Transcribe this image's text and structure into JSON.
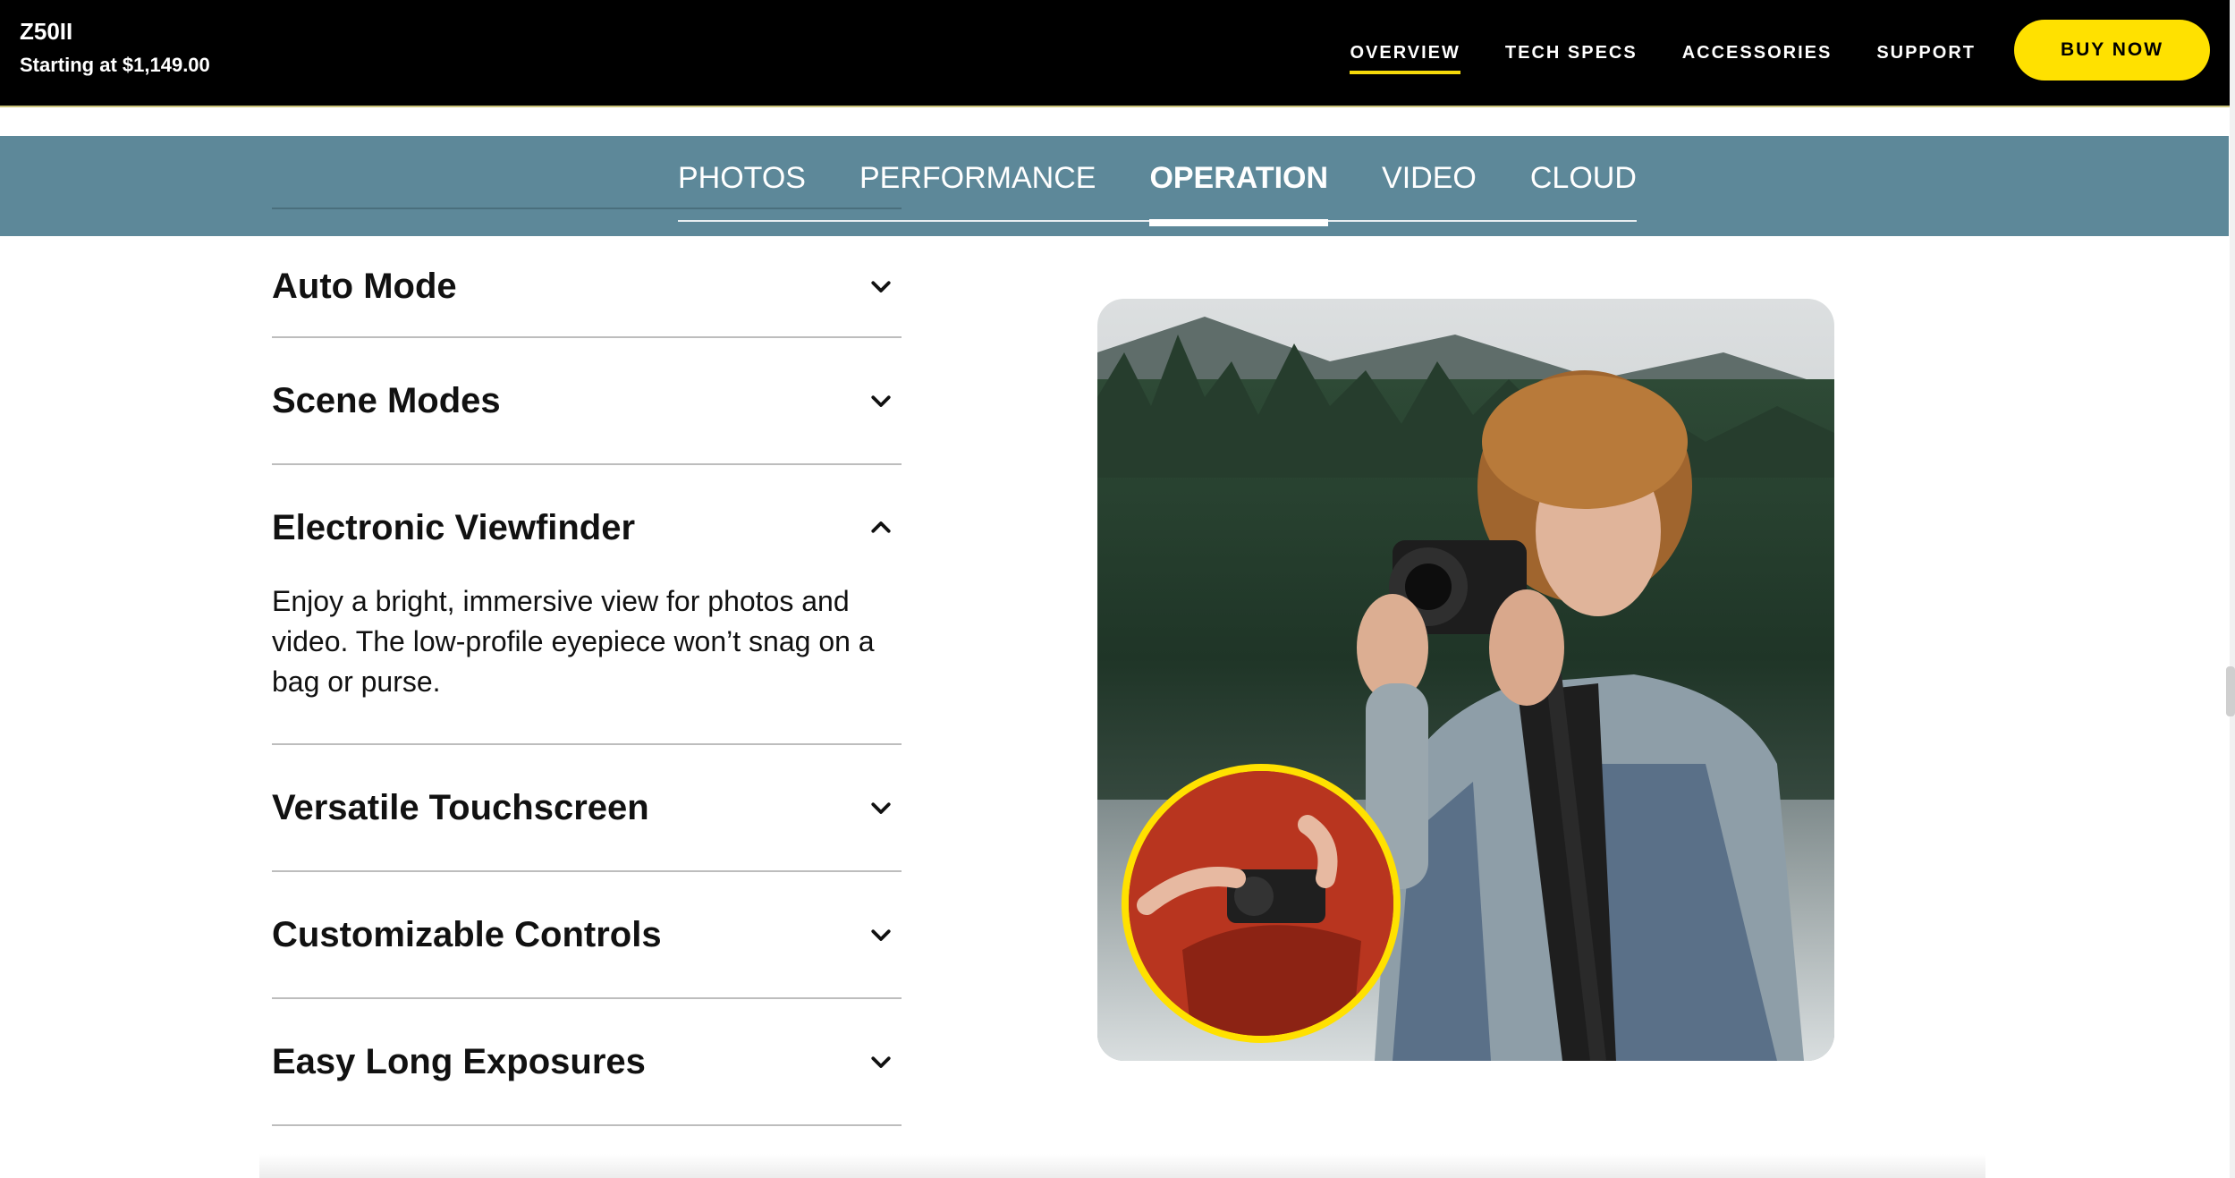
{
  "header": {
    "model": "Z50II",
    "price": "Starting at $1,149.00",
    "nav": [
      {
        "label": "OVERVIEW",
        "active": true
      },
      {
        "label": "TECH SPECS",
        "active": false
      },
      {
        "label": "ACCESSORIES",
        "active": false
      },
      {
        "label": "SUPPORT",
        "active": false
      }
    ],
    "buy_label": "BUY NOW"
  },
  "subnav": {
    "tabs": [
      {
        "label": "PHOTOS",
        "active": false
      },
      {
        "label": "PERFORMANCE",
        "active": false
      },
      {
        "label": "OPERATION",
        "active": true
      },
      {
        "label": "VIDEO",
        "active": false
      },
      {
        "label": "CLOUD",
        "active": false
      }
    ]
  },
  "accordion": {
    "items": [
      {
        "title": "Auto Mode",
        "expanded": false,
        "icon": "chevron-down-icon"
      },
      {
        "title": "Scene Modes",
        "expanded": false,
        "icon": "chevron-down-icon"
      },
      {
        "title": "Electronic Viewfinder",
        "expanded": true,
        "icon": "chevron-up-icon",
        "body": "Enjoy a bright, immersive view for photos and video. The low-profile eyepiece won’t snag on a bag or purse."
      },
      {
        "title": "Versatile Touchscreen",
        "expanded": false,
        "icon": "chevron-down-icon"
      },
      {
        "title": "Customizable Controls",
        "expanded": false,
        "icon": "chevron-down-icon"
      },
      {
        "title": "Easy Long Exposures",
        "expanded": false,
        "icon": "chevron-down-icon"
      }
    ]
  },
  "colors": {
    "accent_yellow": "#ffe100",
    "subnav_bg": "#5d8899",
    "topbar_bg": "#000000"
  }
}
